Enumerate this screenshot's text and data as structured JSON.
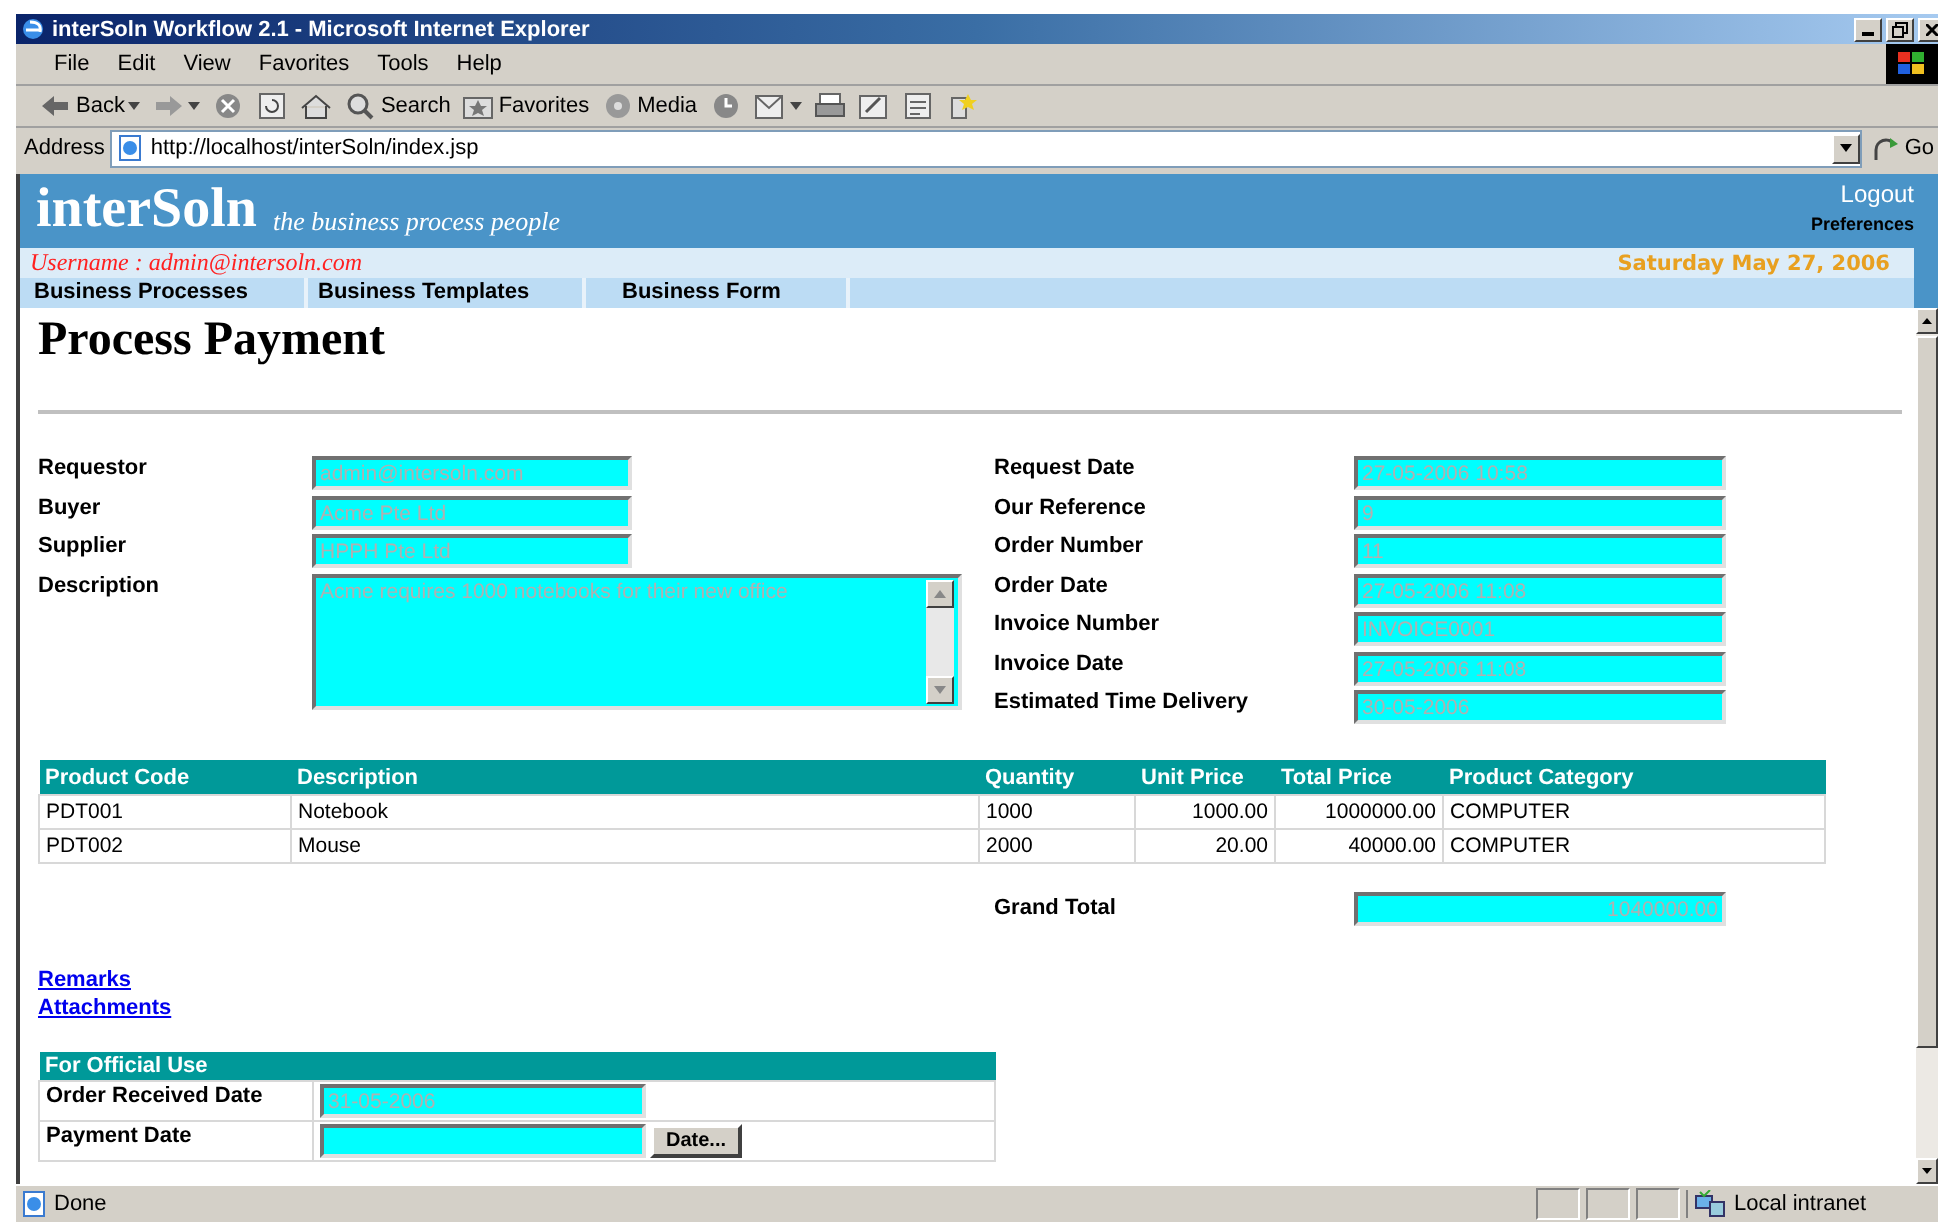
{
  "window": {
    "title": "interSoln Workflow 2.1 - Microsoft Internet Explorer"
  },
  "menu_bar": [
    "File",
    "Edit",
    "View",
    "Favorites",
    "Tools",
    "Help"
  ],
  "toolbar": [
    {
      "kind": "back",
      "label": "Back"
    },
    {
      "kind": "forward"
    },
    {
      "kind": "stop"
    },
    {
      "kind": "refresh"
    },
    {
      "kind": "home"
    },
    {
      "kind": "search",
      "label": "Search"
    },
    {
      "kind": "favorites",
      "label": "Favorites"
    },
    {
      "kind": "media",
      "label": "Media"
    },
    {
      "kind": "history"
    },
    {
      "kind": "mail"
    },
    {
      "kind": "print"
    },
    {
      "kind": "edit"
    },
    {
      "kind": "discuss"
    },
    {
      "kind": "messenger"
    }
  ],
  "address_bar": {
    "label": "Address",
    "url": "http://localhost/interSoln/index.jsp",
    "go": "Go"
  },
  "header": {
    "logo": "interSoln",
    "tagline": "the business process people",
    "logout": "Logout",
    "preferences": "Preferences",
    "username": "Username : admin@intersoln.com",
    "date": "Saturday May 27, 2006"
  },
  "nav_tabs": [
    "Business Processes",
    "Business Templates",
    "Business Form"
  ],
  "page_title": "Process Payment",
  "left_fields": [
    {
      "label": "Requestor",
      "value": "admin@intersoln.com",
      "kind": "text"
    },
    {
      "label": "Buyer",
      "value": "Acme Pte Ltd",
      "kind": "text"
    },
    {
      "label": "Supplier",
      "value": "HPPH Pte Ltd",
      "kind": "text"
    },
    {
      "label": "Description",
      "value": "Acme requires 1000 notebooks for their new office",
      "kind": "textarea"
    }
  ],
  "right_fields": [
    {
      "label": "Request Date",
      "value": "27-05-2006 10:58"
    },
    {
      "label": "Our Reference",
      "value": "9"
    },
    {
      "label": "Order Number",
      "value": "11"
    },
    {
      "label": "Order Date",
      "value": "27-05-2006 11:08"
    },
    {
      "label": "Invoice Number",
      "value": "INVOICE0001"
    },
    {
      "label": "Invoice Date",
      "value": "27-05-2006 11:08"
    },
    {
      "label": "Estimated Time Delivery",
      "value": "30-05-2006"
    }
  ],
  "products": {
    "columns": [
      "Product Code",
      "Description",
      "Quantity",
      "Unit Price",
      "Total Price",
      "Product Category"
    ],
    "rows": [
      [
        "PDT001",
        "Notebook",
        "1000",
        "1000.00",
        "1000000.00",
        "COMPUTER"
      ],
      [
        "PDT002",
        "Mouse",
        "2000",
        "20.00",
        "40000.00",
        "COMPUTER"
      ]
    ]
  },
  "grand_total": {
    "label": "Grand Total",
    "value": "1040000.00"
  },
  "links": [
    "Remarks",
    "Attachments"
  ],
  "official_use": {
    "title": "For Official Use",
    "rows": [
      {
        "label": "Order Received Date",
        "value": "31-05-2006",
        "kind": "text"
      },
      {
        "label": "Payment Date",
        "kind": "date_picker",
        "button": "Date..."
      }
    ]
  },
  "status_bar": {
    "text": "Done",
    "zone": "Local intranet"
  }
}
